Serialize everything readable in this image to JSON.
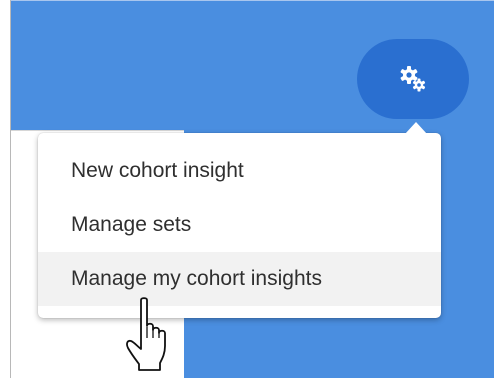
{
  "toolbar": {
    "settings_icon": "gears-icon",
    "accent_color": "#4a8ee0",
    "button_color": "#2a6fd0"
  },
  "menu": {
    "items": [
      {
        "label": "New cohort insight",
        "hovered": false
      },
      {
        "label": "Manage sets",
        "hovered": false
      },
      {
        "label": "Manage my cohort insights",
        "hovered": true
      }
    ]
  },
  "cursor": {
    "icon": "hand-pointer-icon"
  }
}
